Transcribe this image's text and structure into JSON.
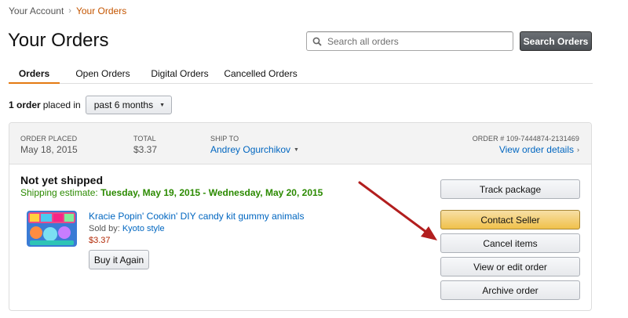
{
  "breadcrumb": {
    "parent": "Your Account",
    "separator": "›",
    "current": "Your Orders"
  },
  "page": {
    "title": "Your Orders"
  },
  "search": {
    "placeholder": "Search all orders",
    "value": "",
    "button_label": "Search Orders"
  },
  "tabs": [
    {
      "label": "Orders",
      "active": true
    },
    {
      "label": "Open Orders",
      "active": false
    },
    {
      "label": "Digital Orders",
      "active": false
    },
    {
      "label": "Cancelled Orders",
      "active": false
    }
  ],
  "filter": {
    "count": "1 order",
    "text": "placed in",
    "period": "past 6 months"
  },
  "order": {
    "placed_label": "ORDER PLACED",
    "placed_value": "May 18, 2015",
    "total_label": "TOTAL",
    "total_value": "$3.37",
    "ship_to_label": "SHIP TO",
    "ship_to_value": "Andrey Ogurchikov",
    "order_number_label": "ORDER # 109-7444874-2131469",
    "details_link": "View order details",
    "status": "Not yet shipped",
    "estimate_label": "Shipping estimate:",
    "estimate_value": "Tuesday, May 19, 2015 - Wednesday, May 20, 2015",
    "item": {
      "title": "Kracie Popin' Cookin' DIY candy kit gummy animals",
      "sold_by_label": "Sold by:",
      "seller": "Kyoto style",
      "price": "$3.37",
      "buy_again_label": "Buy it Again"
    },
    "actions": {
      "track": "Track package",
      "contact": "Contact Seller",
      "cancel": "Cancel items",
      "view_edit": "View or edit order",
      "archive": "Archive order"
    }
  },
  "colors": {
    "accent": "#e47911",
    "link": "#0066c0",
    "price": "#b12704",
    "shipping": "#2b8a00",
    "arrow": "#b21e1e"
  },
  "icons": {
    "search": "search-icon",
    "dropdown": "caret-down-icon",
    "details": "chevron-right-icon"
  }
}
